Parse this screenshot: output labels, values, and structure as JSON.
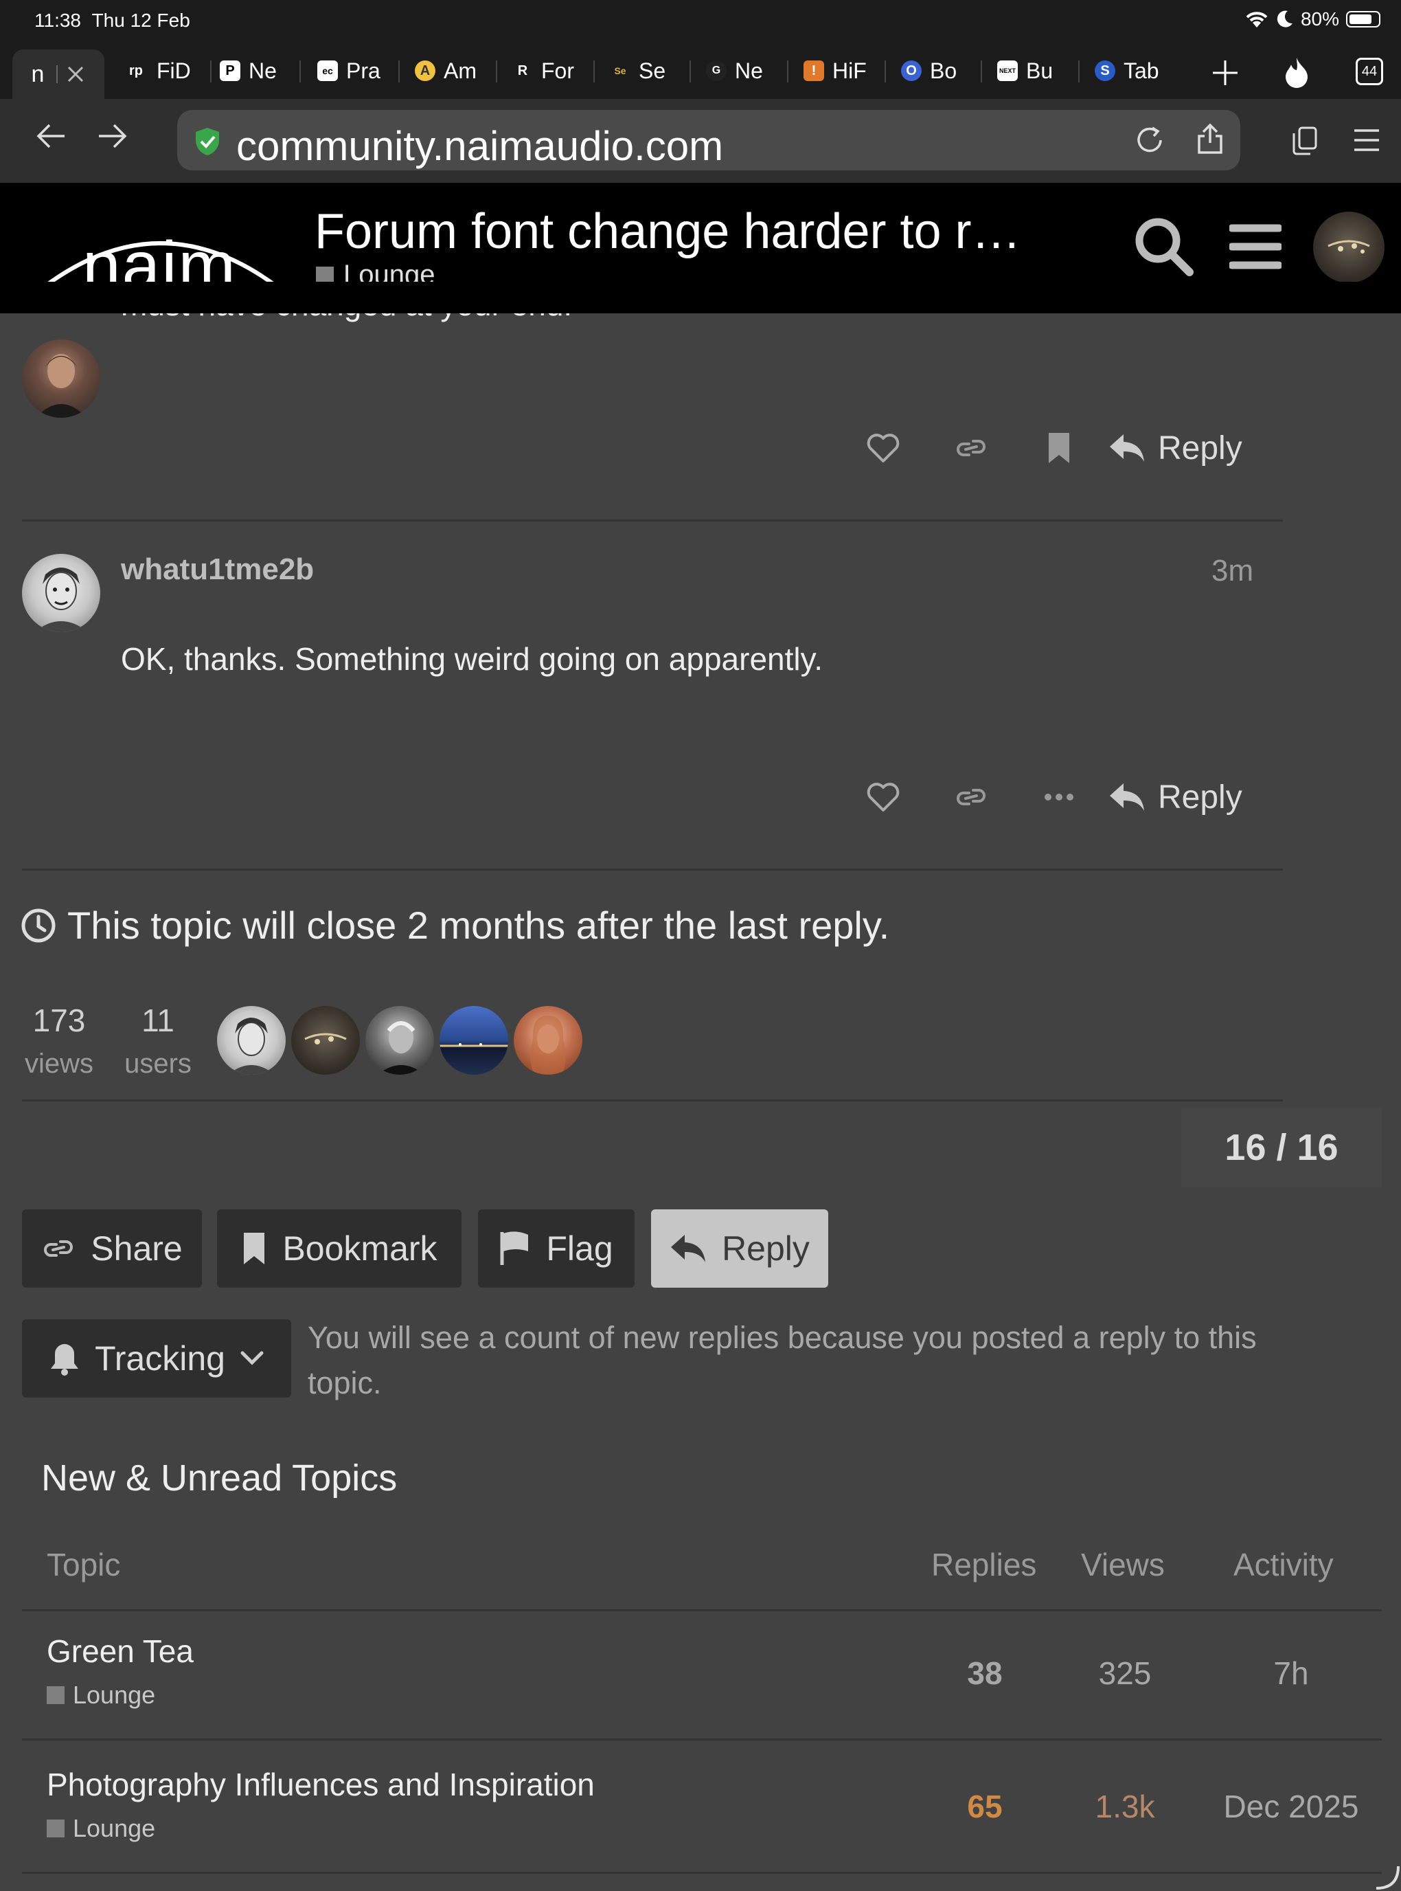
{
  "status_bar": {
    "time": "11:38",
    "date": "Thu 12 Feb",
    "battery": "80%",
    "icons": [
      "wifi-icon",
      "moon-icon",
      "battery-icon"
    ]
  },
  "tabs": [
    {
      "favicon": "n",
      "label": "",
      "active": true
    },
    {
      "favicon": "rp",
      "label": "FiD"
    },
    {
      "favicon": "P",
      "label": "Ne"
    },
    {
      "favicon": "ec",
      "label": "Pra"
    },
    {
      "favicon": "A",
      "label": "Am"
    },
    {
      "favicon": "R",
      "label": "For"
    },
    {
      "favicon": "Se",
      "label": "Se"
    },
    {
      "favicon": "G",
      "label": "Ne"
    },
    {
      "favicon": "!",
      "label": "HiF"
    },
    {
      "favicon": "O",
      "label": "Bo"
    },
    {
      "favicon": "NEXT",
      "label": "Bu"
    },
    {
      "favicon": "S",
      "label": "Tab"
    }
  ],
  "tab_count": "44",
  "address": {
    "url": "community.naimaudio.com"
  },
  "header": {
    "logo": "naim",
    "title": "Forum font change harder to r…",
    "category": "Lounge"
  },
  "previous_post": {
    "partial_text": "must have changed at your end.",
    "reply_label": "Reply"
  },
  "post": {
    "username": "whatu1tme2b",
    "time": "3m",
    "body": "OK, thanks. Something weird going on apparently.",
    "reply_label": "Reply"
  },
  "close_notice": "This topic will close 2 months after the last reply.",
  "stats": {
    "views_count": "173",
    "views_label": "views",
    "users_count": "11",
    "users_label": "users"
  },
  "progress": "16 / 16",
  "buttons": {
    "share": "Share",
    "bookmark": "Bookmark",
    "flag": "Flag",
    "reply": "Reply"
  },
  "tracking": {
    "label": "Tracking",
    "description": "You will see a count of new replies because you posted a reply to this topic."
  },
  "suggested": {
    "heading": "New & Unread Topics",
    "columns": {
      "topic": "Topic",
      "replies": "Replies",
      "views": "Views",
      "activity": "Activity"
    },
    "rows": [
      {
        "title": "Green Tea",
        "category": "Lounge",
        "replies": "38",
        "views": "325",
        "activity": "7h"
      },
      {
        "title": "Photography Influences and Inspiration",
        "category": "Lounge",
        "replies": "65",
        "views": "1.3k",
        "activity": "Dec 2025"
      }
    ]
  },
  "colors": {
    "accent_orange": "#d08a44",
    "muted_orange": "#b8876a",
    "background": "#424242",
    "header": "#000000",
    "online_green": "#3aa64a"
  }
}
